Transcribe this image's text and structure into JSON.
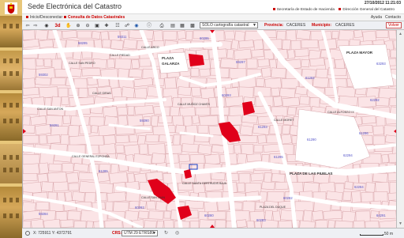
{
  "header": {
    "app_title": "Sede Electrónica del Catastro",
    "datetime": "27/10/2012 11:21:03",
    "links": [
      "Secretaría de Estado de Hacienda",
      "Dirección General del Catastro"
    ]
  },
  "tabs": {
    "inicio": "Inicio/Desconectar",
    "consulta": "Consulta de Datos Catastrales",
    "ayuda": "Ayuda",
    "contacto": "Contacto"
  },
  "toolbar": {
    "layer": "SOLO cartografía catastral",
    "provincia_label": "Provincia:",
    "provincia_value": "CACERES",
    "municipio_label": "Municipio:",
    "municipio_value": "CACERES",
    "volver": "Volver",
    "icons": [
      "back-icon",
      "forward-icon",
      "binoculars-icon",
      "3d-icon",
      "pan-icon",
      "zoom-in-icon",
      "zoom-out-icon",
      "zoom-box-icon",
      "zoom-extent-icon",
      "reference-icon",
      "identify-icon",
      "measure-icon",
      "print-icon",
      "info-icon"
    ],
    "zoom_label": "3d"
  },
  "map": {
    "labels": [
      {
        "t": "PLAZA",
        "cls": "big"
      },
      {
        "t": "GALARZA",
        "cls": "big"
      },
      {
        "t": "PLAZA MAYOR",
        "cls": "big"
      },
      {
        "t": "PLAZA DE LAS PIUELAS",
        "cls": "big"
      },
      {
        "t": "CALLE SAN PEDRO",
        "cls": ""
      },
      {
        "t": "CALLE PIEDAD",
        "cls": ""
      },
      {
        "t": "CALLE GIRAS",
        "cls": ""
      },
      {
        "t": "CALLE ARCO",
        "cls": ""
      },
      {
        "t": "CALLE GENERAL EZPONDA",
        "cls": ""
      },
      {
        "t": "CALLE SAN ANTON",
        "cls": ""
      },
      {
        "t": "CALLE MUÑOZ CHAVES",
        "cls": ""
      },
      {
        "t": "CALLE SANTA GERTRUDIS BAJA",
        "cls": ""
      },
      {
        "t": "CALLE SAN JUAN",
        "cls": ""
      },
      {
        "t": "CALLE ALFONSO IX",
        "cls": ""
      },
      {
        "t": "CALLE MORET",
        "cls": ""
      },
      {
        "t": "PLAZA DEL DUQUE",
        "cls": ""
      },
      {
        "t": "59311",
        "cls": "blue"
      },
      {
        "t": "59297",
        "cls": "blue"
      },
      {
        "t": "59302",
        "cls": "blue"
      },
      {
        "t": "60293",
        "cls": "blue"
      },
      {
        "t": "59291",
        "cls": "blue"
      },
      {
        "t": "61293",
        "cls": "blue"
      },
      {
        "t": "61296",
        "cls": "blue"
      },
      {
        "t": "62294",
        "cls": "blue"
      },
      {
        "t": "59284",
        "cls": "blue"
      },
      {
        "t": "60293",
        "cls": "blue"
      },
      {
        "t": "61295",
        "cls": "blue"
      },
      {
        "t": "62292",
        "cls": "blue"
      },
      {
        "t": "60280",
        "cls": "blue"
      },
      {
        "t": "61285",
        "cls": "blue"
      },
      {
        "t": "60283",
        "cls": "blue"
      },
      {
        "t": "60282",
        "cls": "blue"
      },
      {
        "t": "61292",
        "cls": "blue"
      },
      {
        "t": "62284",
        "cls": "blue"
      },
      {
        "t": "63293",
        "cls": "blue"
      },
      {
        "t": "64291",
        "cls": "blue"
      },
      {
        "t": "58295",
        "cls": "blue"
      },
      {
        "t": "60295",
        "cls": "blue"
      },
      {
        "t": "59290",
        "cls": "blue"
      },
      {
        "t": "61290",
        "cls": "blue"
      }
    ]
  },
  "status": {
    "coords": "X: 725911 Y: 4372791",
    "crs_label": "CRS:",
    "crs_value": "UTM 29 ETRS89",
    "scale": "50 m"
  },
  "colors": {
    "accent": "#cc0000",
    "parcel_fill": "#fbe4e6",
    "parcel_stroke": "#d9a0a6",
    "street": "#ffffff",
    "highlight": "#e0001a",
    "header_bg": "#ffffff",
    "strip": "#e8c77a"
  }
}
